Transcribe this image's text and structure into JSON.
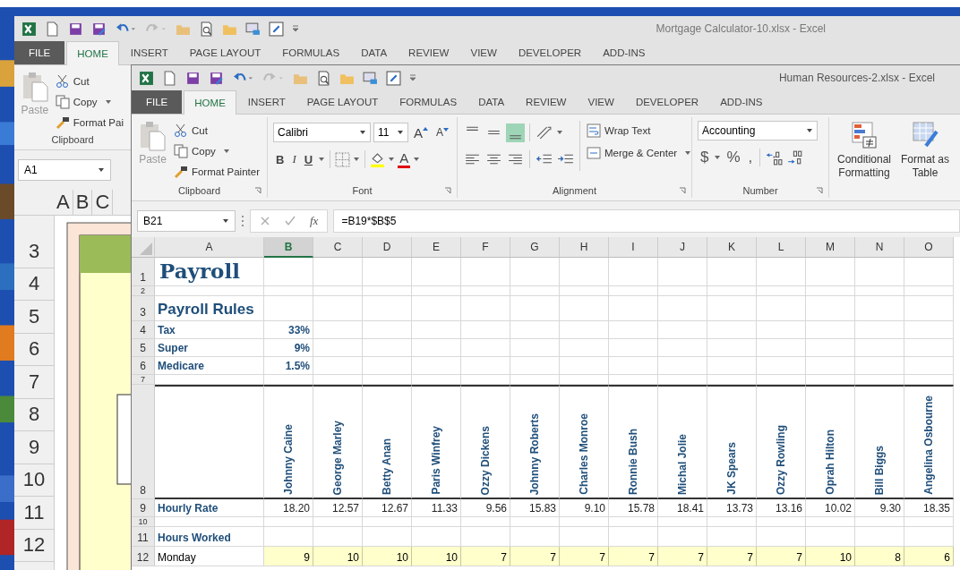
{
  "back_window": {
    "title": "Mortgage Calculator-10.xlsx - Excel",
    "tabs": [
      {
        "label": "FILE",
        "kind": "file",
        "selected": false
      },
      {
        "label": "HOME",
        "kind": "tab",
        "selected": true
      },
      {
        "label": "INSERT",
        "kind": "tab",
        "selected": false
      },
      {
        "label": "PAGE LAYOUT",
        "kind": "tab",
        "selected": false
      },
      {
        "label": "FORMULAS",
        "kind": "tab",
        "selected": false
      },
      {
        "label": "DATA",
        "kind": "tab",
        "selected": false
      },
      {
        "label": "REVIEW",
        "kind": "tab",
        "selected": false
      },
      {
        "label": "VIEW",
        "kind": "tab",
        "selected": false
      },
      {
        "label": "DEVELOPER",
        "kind": "tab",
        "selected": false
      },
      {
        "label": "ADD-INS",
        "kind": "tab",
        "selected": false
      }
    ],
    "clipboard": {
      "paste": "Paste",
      "cut": "Cut",
      "copy": "Copy",
      "format_painter": "Format Pai",
      "label": "Clipboard"
    },
    "name_box": "A1",
    "column_headers": [
      "A",
      "B",
      "C"
    ],
    "row_headers": [
      "3",
      "4",
      "5",
      "6",
      "7",
      "8",
      "9",
      "10",
      "11",
      "12"
    ]
  },
  "front_window": {
    "title": "Human Resources-2.xlsx - Excel",
    "tabs": [
      {
        "label": "FILE",
        "kind": "file",
        "selected": false
      },
      {
        "label": "HOME",
        "kind": "tab",
        "selected": true
      },
      {
        "label": "INSERT",
        "kind": "tab",
        "selected": false
      },
      {
        "label": "PAGE LAYOUT",
        "kind": "tab",
        "selected": false
      },
      {
        "label": "FORMULAS",
        "kind": "tab",
        "selected": false
      },
      {
        "label": "DATA",
        "kind": "tab",
        "selected": false
      },
      {
        "label": "REVIEW",
        "kind": "tab",
        "selected": false
      },
      {
        "label": "VIEW",
        "kind": "tab",
        "selected": false
      },
      {
        "label": "DEVELOPER",
        "kind": "tab",
        "selected": false
      },
      {
        "label": "ADD-INS",
        "kind": "tab",
        "selected": false
      }
    ],
    "clipboard": {
      "paste": "Paste",
      "cut": "Cut",
      "copy": "Copy",
      "format_painter": "Format Painter",
      "label": "Clipboard"
    },
    "font": {
      "name": "Calibri",
      "size": "11",
      "grow": "A",
      "shrink": "A",
      "bold": "B",
      "italic": "I",
      "underline": "U",
      "font_color": "A",
      "label": "Font"
    },
    "alignment": {
      "vertical_align": [
        {
          "selected": false
        },
        {
          "selected": false
        },
        {
          "selected": true
        }
      ],
      "wrap_text": "Wrap Text",
      "merge_center": "Merge & Center",
      "label": "Alignment"
    },
    "number": {
      "format": "Accounting",
      "currency": "$",
      "percent": "%",
      "comma": ",",
      "label": "Number"
    },
    "styles": {
      "conditional_formatting": "Conditional Formatting",
      "format_as_table": "Format as Table"
    },
    "name_box": "B21",
    "formula_label": "fx",
    "formula": "=B19*$B$5",
    "columns": [
      {
        "label": "A",
        "selected": false
      },
      {
        "label": "B",
        "selected": true
      },
      {
        "label": "C",
        "selected": false
      },
      {
        "label": "D",
        "selected": false
      },
      {
        "label": "E",
        "selected": false
      },
      {
        "label": "F",
        "selected": false
      },
      {
        "label": "G",
        "selected": false
      },
      {
        "label": "H",
        "selected": false
      },
      {
        "label": "I",
        "selected": false
      },
      {
        "label": "J",
        "selected": false
      },
      {
        "label": "K",
        "selected": false
      },
      {
        "label": "L",
        "selected": false
      },
      {
        "label": "M",
        "selected": false
      },
      {
        "label": "N",
        "selected": false
      },
      {
        "label": "O",
        "selected": false
      }
    ],
    "rows": [
      {
        "num": "1",
        "kind": "title",
        "label": "Payroll"
      },
      {
        "num": "2",
        "kind": "blank"
      },
      {
        "num": "3",
        "kind": "heading",
        "label": "Payroll Rules"
      },
      {
        "num": "4",
        "kind": "rule",
        "label": "Tax",
        "values": [
          "33%"
        ]
      },
      {
        "num": "5",
        "kind": "rule",
        "label": "Super",
        "values": [
          "9%"
        ]
      },
      {
        "num": "6",
        "kind": "rule",
        "label": "Medicare",
        "values": [
          "1.5%"
        ]
      },
      {
        "num": "7",
        "kind": "blank"
      },
      {
        "num": "8",
        "kind": "names",
        "values": [
          "Johnny Caine",
          "George Marley",
          "Betty Anan",
          "Paris Winfrey",
          "Ozzy Dickens",
          "Johnny Roberts",
          "Charles Monroe",
          "Ronnie Bush",
          "Michal Jolie",
          "JK Spears",
          "Ozzy Rowling",
          "Oprah Hilton",
          "Bill Biggs",
          "Angelina Osbourne"
        ]
      },
      {
        "num": "9",
        "kind": "rate",
        "label": "Hourly Rate",
        "values": [
          "18.20",
          "12.57",
          "12.67",
          "11.33",
          "9.56",
          "15.83",
          "9.10",
          "15.78",
          "18.41",
          "13.73",
          "13.16",
          "10.02",
          "9.30",
          "18.35"
        ]
      },
      {
        "num": "10",
        "kind": "blank"
      },
      {
        "num": "11",
        "kind": "section",
        "label": "Hours Worked"
      },
      {
        "num": "12",
        "kind": "day",
        "label": "Monday",
        "values": [
          "9",
          "10",
          "10",
          "10",
          "7",
          "7",
          "7",
          "7",
          "7",
          "7",
          "7",
          "10",
          "8",
          "6"
        ]
      }
    ]
  }
}
